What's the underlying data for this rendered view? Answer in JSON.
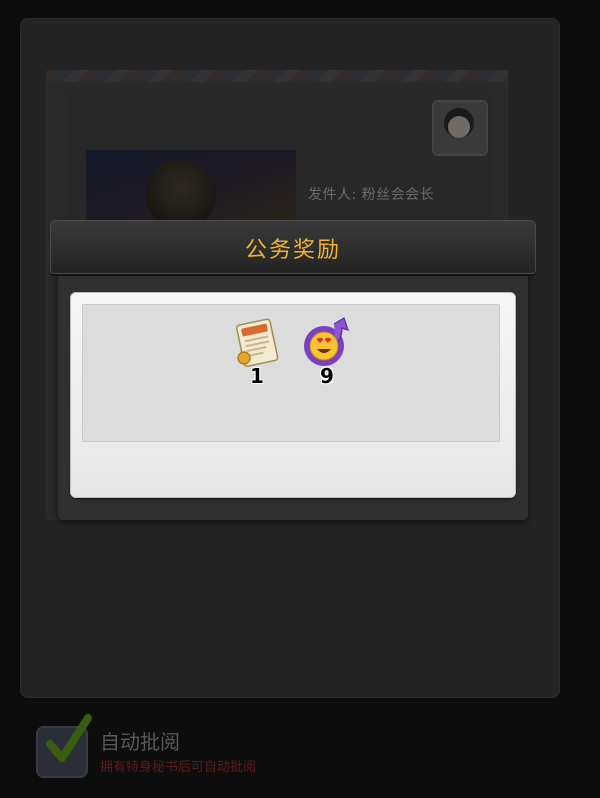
{
  "background": {
    "sender_label": "发件人: 粉丝会会长"
  },
  "dialog": {
    "title": "公务奖励",
    "rewards": [
      {
        "name": "工作函",
        "icon": "work-letter-icon",
        "quantity": "1"
      },
      {
        "name": "mood-up",
        "icon": "heart-eyes-up-icon",
        "quantity": "9"
      }
    ]
  },
  "auto_review": {
    "label": "自动批阅",
    "hint": "拥有特身秘书后可自动批阅",
    "checked": true
  },
  "colors": {
    "title_gold": "#f0b233",
    "check_green": "#6aa51f"
  }
}
